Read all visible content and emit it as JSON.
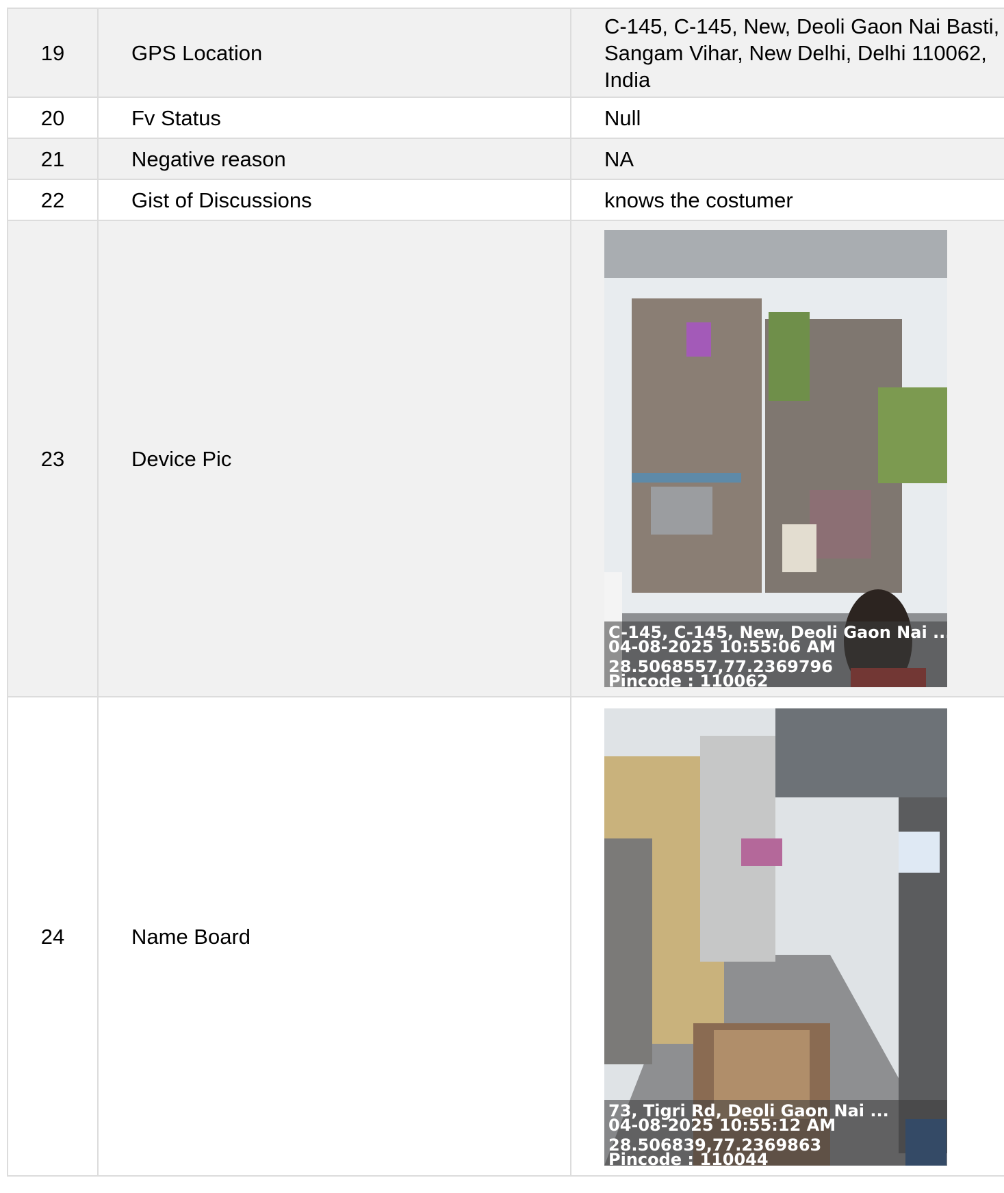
{
  "rows": [
    {
      "no": "19",
      "field": "GPS Location",
      "value": "C-145, C-145, New, Deoli Gaon Nai Basti, Sangam Vihar, New Delhi, Delhi 110062, India"
    },
    {
      "no": "20",
      "field": "Fv Status",
      "value": "Null"
    },
    {
      "no": "21",
      "field": "Negative reason",
      "value": "NA"
    },
    {
      "no": "22",
      "field": "Gist of Discussions",
      "value": "knows the costumer"
    },
    {
      "no": "23",
      "field": "Device Pic"
    },
    {
      "no": "24",
      "field": "Name Board"
    }
  ],
  "device_pic": {
    "address": "C-145, C-145, New, Deoli Gaon Nai ...",
    "datetime": "04-08-2025 10:55:06 AM",
    "coords": "28.5068557,77.2369796",
    "pincode": "Pincode : 110062"
  },
  "name_board_pic": {
    "address": "73, Tigri Rd, Deoli Gaon Nai ...",
    "datetime": "04-08-2025 10:55:12 AM",
    "coords": "28.506839,77.2369863",
    "pincode": "Pincode : 110044"
  },
  "colors": {
    "shaded_row": "#f1f1f1",
    "border": "#dcdcdc"
  }
}
